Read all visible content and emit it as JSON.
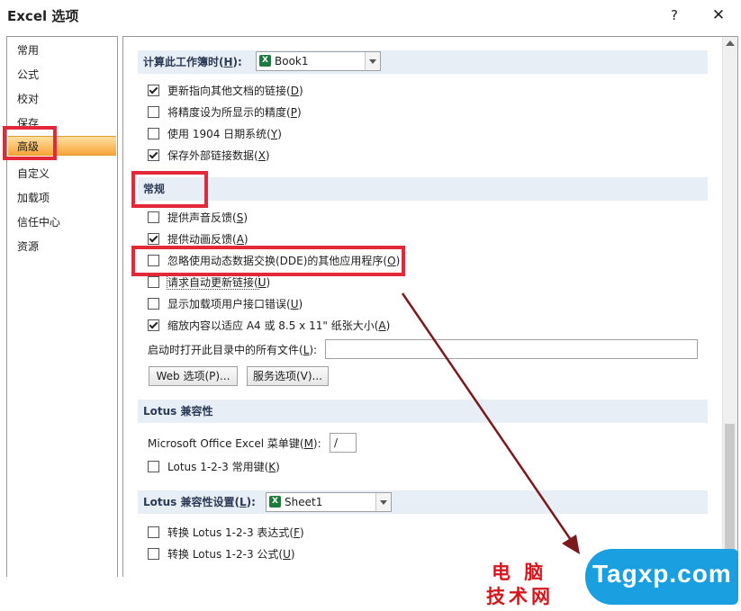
{
  "window": {
    "title": "Excel 选项",
    "help": "?",
    "close": "✕"
  },
  "sidebar": {
    "items": [
      {
        "label": "常用"
      },
      {
        "label": "公式"
      },
      {
        "label": "校对"
      },
      {
        "label": "保存"
      },
      {
        "label": "高级",
        "selected": true
      },
      {
        "label": "自定义"
      },
      {
        "label": "加载项"
      },
      {
        "label": "信任中心"
      },
      {
        "label": "资源"
      }
    ]
  },
  "workbook_section": {
    "header_pre": "计算此工作簿时(",
    "header_key": "H",
    "header_post": "):",
    "combo_value": "Book1",
    "options": [
      {
        "pre": "更新指向其他文档的链接(",
        "key": "D",
        "post": ")",
        "checked": true
      },
      {
        "pre": "将精度设为所显示的精度(",
        "key": "P",
        "post": ")",
        "checked": false
      },
      {
        "pre": "使用 1904 日期系统(",
        "key": "Y",
        "post": ")",
        "checked": false
      },
      {
        "pre": "保存外部链接数据(",
        "key": "X",
        "post": ")",
        "checked": true
      }
    ]
  },
  "general_section": {
    "header": "常规",
    "options": [
      {
        "pre": "提供声音反馈(",
        "key": "S",
        "post": ")",
        "checked": false
      },
      {
        "pre": "提供动画反馈(",
        "key": "A",
        "post": ")",
        "checked": true
      },
      {
        "pre": "忽略使用动态数据交换(DDE)的其他应用程序(",
        "key": "O",
        "post": ")",
        "checked": false
      },
      {
        "pre": "请求自动更新链接(",
        "key": "U",
        "post": ")",
        "checked": false
      },
      {
        "pre": "显示加载项用户接口错误(",
        "key": "U",
        "post": ")",
        "checked": false
      },
      {
        "pre": "缩放内容以适应 A4 或 8.5 x 11\" 纸张大小(",
        "key": "A",
        "post": ")",
        "checked": true
      }
    ],
    "startup_label_pre": "启动时打开此目录中的所有文件(",
    "startup_label_key": "L",
    "startup_label_post": "):",
    "startup_value": "",
    "web_options_button": "Web 选项(P)...",
    "service_options_button": "服务选项(V)..."
  },
  "lotus_section": {
    "header": "Lotus 兼容性",
    "menu_key_label_pre": "Microsoft Office Excel 菜单键(",
    "menu_key_label_key": "M",
    "menu_key_label_post": "):",
    "menu_key_value": "/",
    "nav_keys": {
      "pre": "Lotus 1-2-3 常用键(",
      "key": "K",
      "post": ")",
      "checked": false
    }
  },
  "lotus_settings_section": {
    "header_pre": "Lotus 兼容性设置(",
    "header_key": "L",
    "header_post": "):",
    "combo_value": "Sheet1",
    "options": [
      {
        "pre": "转换 Lotus 1-2-3 表达式(",
        "key": "F",
        "post": ")",
        "checked": false
      },
      {
        "pre": "转换 Lotus 1-2-3 公式(",
        "key": "U",
        "post": ")",
        "checked": false
      }
    ]
  },
  "watermark": {
    "cn_line1": "电 脑",
    "cn_line2": "技术网",
    "latin": "Tagxp.com"
  },
  "colors": {
    "highlight_red": "#e3283a",
    "arrow": "#7a1a1f",
    "selected_nav": "#f7a53a",
    "section_header_bg": "#e8eef5"
  }
}
